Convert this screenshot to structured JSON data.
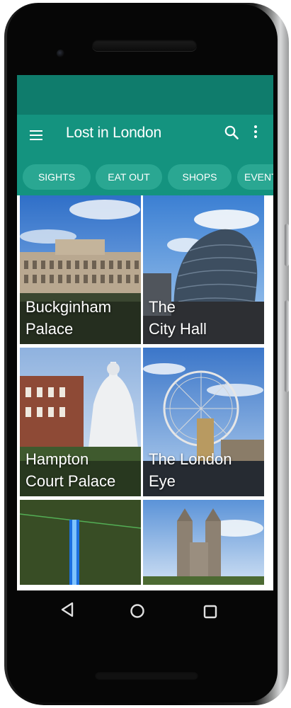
{
  "app": {
    "title": "Lost in London"
  },
  "toolbar": {
    "menu_icon": "hamburger-icon",
    "search_icon": "search-icon",
    "more_icon": "more-vert-icon"
  },
  "tabs": [
    {
      "label": "SIGHTS",
      "selected": true
    },
    {
      "label": "EAT OUT"
    },
    {
      "label": "SHOPS"
    },
    {
      "label": "EVENTS"
    }
  ],
  "places": [
    {
      "name": "Buckginham\nPalace"
    },
    {
      "name": "The\nCity Hall"
    },
    {
      "name": "Hampton\nCourt Palace"
    },
    {
      "name": "The London\nEye"
    },
    {
      "name": ""
    },
    {
      "name": ""
    }
  ],
  "navigation": {
    "back_icon": "back-triangle-icon",
    "home_icon": "home-circle-icon",
    "recents_icon": "recents-square-icon"
  },
  "colors": {
    "primary": "#14937f",
    "primary_dark": "#0f7c6c",
    "chip": "#2aa792"
  }
}
